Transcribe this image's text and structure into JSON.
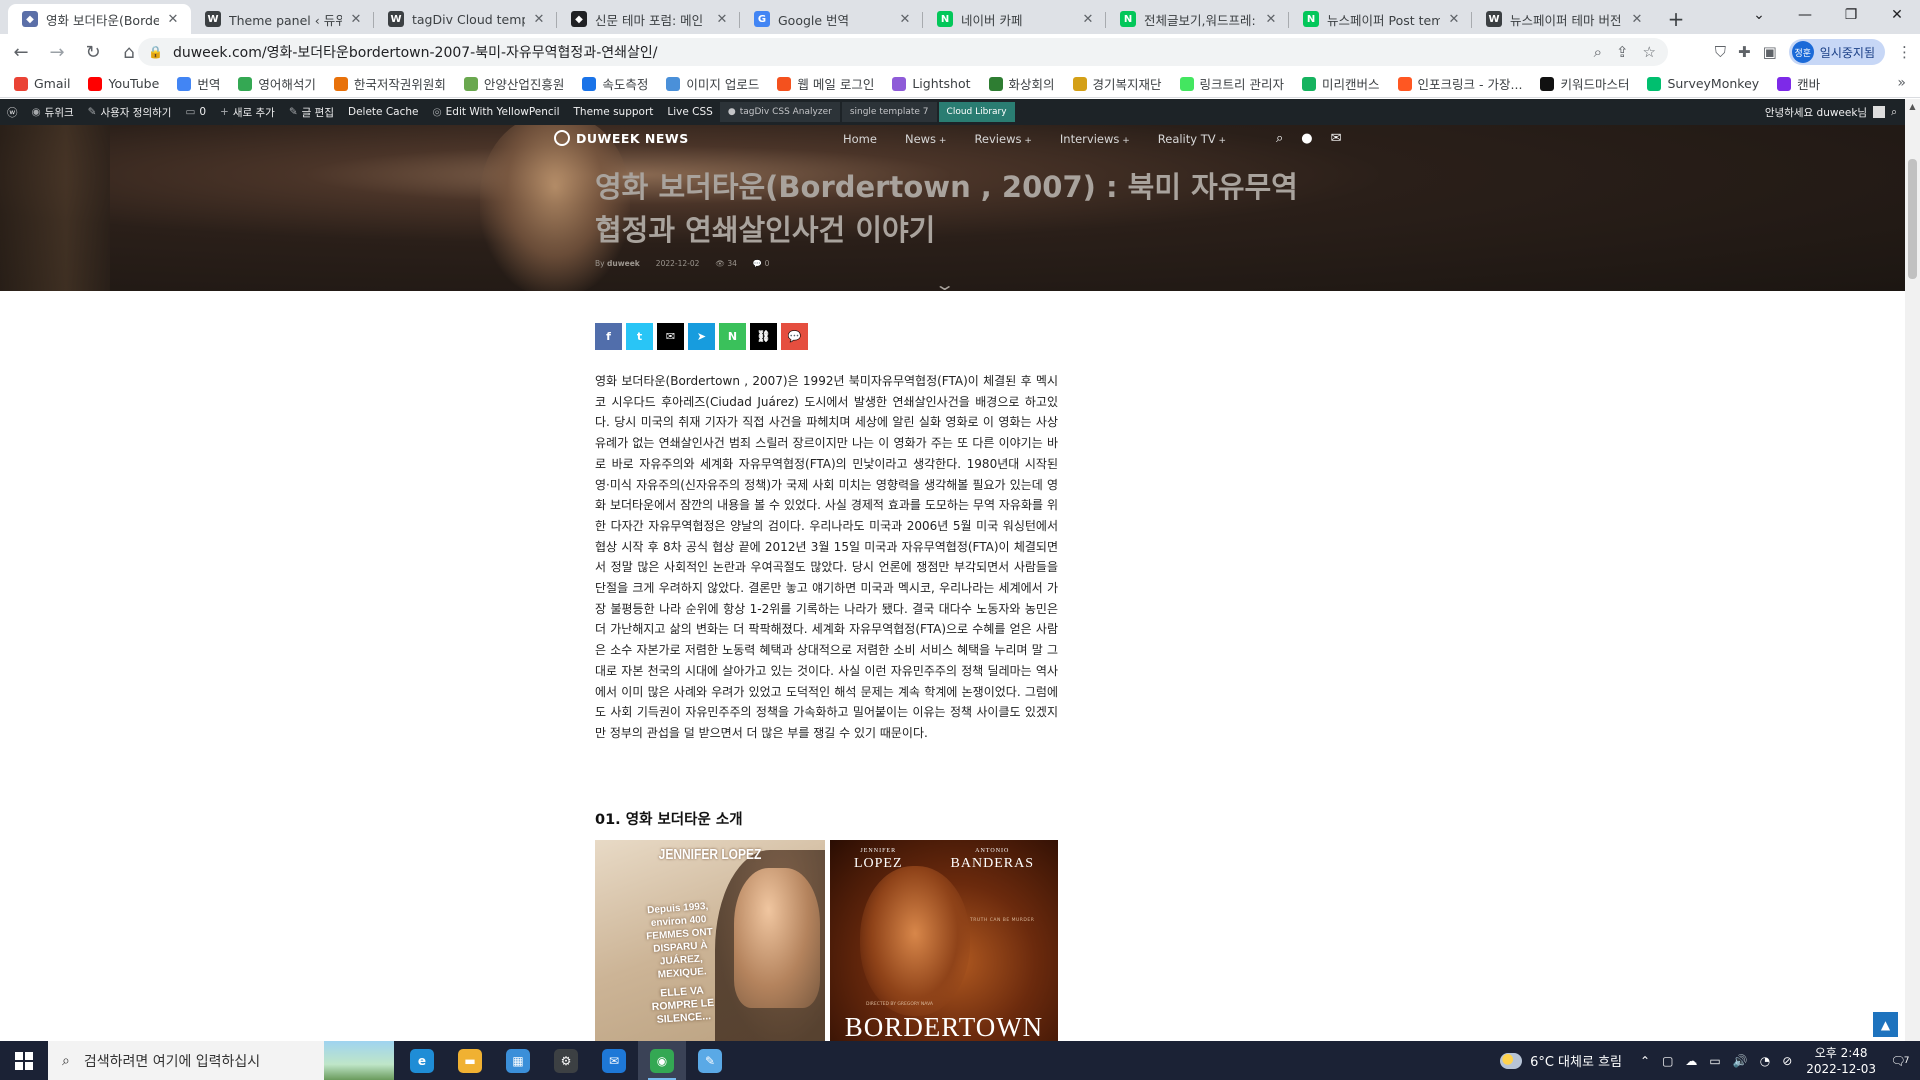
{
  "browser": {
    "tabs": [
      {
        "title": "영화 보더타운(Border",
        "favicon": "gear-icon",
        "color": "#5b6fa8",
        "active": true
      },
      {
        "title": "Theme panel ‹ 듀위크",
        "favicon": "wordpress-icon",
        "color": "#3c4043",
        "active": false
      },
      {
        "title": "tagDiv Cloud templat",
        "favicon": "wordpress-icon",
        "color": "#3c4043",
        "active": false
      },
      {
        "title": "신문 테마 포럼: 메인",
        "favicon": "tagdiv-icon",
        "color": "#202124",
        "active": false
      },
      {
        "title": "Google 번역",
        "favicon": "google-translate-icon",
        "color": "#4285f4",
        "active": false
      },
      {
        "title": "네이버 카페",
        "favicon": "naver-cafe-icon",
        "color": "#03c75a",
        "active": false
      },
      {
        "title": "전체글보기,워드프레:",
        "favicon": "naver-cafe-icon",
        "color": "#03c75a",
        "active": false
      },
      {
        "title": "뉴스페이퍼 Post temp",
        "favicon": "naver-cafe-icon",
        "color": "#03c75a",
        "active": false
      },
      {
        "title": "뉴스페이퍼 테마 버전",
        "favicon": "wordpress-icon",
        "color": "#3c4043",
        "active": false
      }
    ],
    "url": "duweek.com/영화-보더타운bordertown-2007-북미-자유무역협정과-연쇄살인/",
    "profile_label": "일시중지됨",
    "profile_avatar": "정훈"
  },
  "bookmarks": [
    {
      "label": "Gmail",
      "color": "#ea4335",
      "icon": "gmail-icon"
    },
    {
      "label": "YouTube",
      "color": "#ff0000",
      "icon": "youtube-icon"
    },
    {
      "label": "번역",
      "color": "#4285f4",
      "icon": "translate-icon"
    },
    {
      "label": "영어해석기",
      "color": "#34a853",
      "icon": "app-icon"
    },
    {
      "label": "한국저작권위원회",
      "color": "#e8710a",
      "icon": "copyright-icon"
    },
    {
      "label": "안양산업진흥원",
      "color": "#6aa84f",
      "icon": "org-icon"
    },
    {
      "label": "속도측정",
      "color": "#1a73e8",
      "icon": "speed-icon"
    },
    {
      "label": "이미지 업로드",
      "color": "#4a90d9",
      "icon": "image-icon"
    },
    {
      "label": "웹 메일 로그인",
      "color": "#f4511e",
      "icon": "mail-icon"
    },
    {
      "label": "Lightshot",
      "color": "#8e5bd8",
      "icon": "lightshot-icon"
    },
    {
      "label": "화상회의",
      "color": "#2e7d32",
      "icon": "video-icon"
    },
    {
      "label": "경기복지재단",
      "color": "#d4a017",
      "icon": "org-icon"
    },
    {
      "label": "링크트리 관리자",
      "color": "#43e660",
      "icon": "linktree-icon"
    },
    {
      "label": "미리캔버스",
      "color": "#16b35f",
      "icon": "canvas-icon"
    },
    {
      "label": "인포크링크 - 가장...",
      "color": "#ff5722",
      "icon": "link-icon"
    },
    {
      "label": "키워드마스터",
      "color": "#111111",
      "icon": "keyword-icon"
    },
    {
      "label": "SurveyMonkey",
      "color": "#00bf6f",
      "icon": "survey-icon"
    },
    {
      "label": "캔바",
      "color": "#7d2ae8",
      "icon": "canva-icon"
    }
  ],
  "adminbar": {
    "items": [
      "듀위크",
      "사용자 정의하기",
      "0",
      "새로 추가",
      "글 편집",
      "Delete Cache",
      "Edit With YellowPencil",
      "Theme support",
      "Live CSS"
    ],
    "tools": [
      "tagDiv CSS Analyzer",
      "single template 7",
      "Cloud Library"
    ],
    "greeting": "안녕하세요 duweek님"
  },
  "site": {
    "logo": "DUWEEK NEWS",
    "menu": [
      "Home",
      "News",
      "Reviews",
      "Interviews",
      "Reality TV"
    ],
    "headline": "영화 보더타운(Bordertown , 2007) : 북미 자유무역협정과 연쇄살인사건 이야기",
    "meta": {
      "by": "By",
      "author": "duweek",
      "date": "2022-12-02",
      "views": "34",
      "comments": "0"
    },
    "share": [
      {
        "name": "facebook-share-button",
        "glyph": "f",
        "color": "#516eab"
      },
      {
        "name": "twitter-share-button",
        "glyph": "t",
        "color": "#29c5f6"
      },
      {
        "name": "email-share-button",
        "glyph": "✉",
        "color": "#000000"
      },
      {
        "name": "telegram-share-button",
        "glyph": "➤",
        "color": "#179cde"
      },
      {
        "name": "naver-share-button",
        "glyph": "N",
        "color": "#3ac15b"
      },
      {
        "name": "copy-link-button",
        "glyph": "⛓",
        "color": "#000000"
      },
      {
        "name": "kakao-share-button",
        "glyph": "💬",
        "color": "#e54e3f"
      }
    ],
    "body": "영화 보더타운(Bordertown , 2007)은 1992년 북미자유무역협정(FTA)이 체결된 후 멕시코 시우다드 후아레즈(Ciudad Juárez) 도시에서 발생한 연쇄살인사건을 배경으로 하고있다. 당시 미국의 취재 기자가 직접 사건을 파헤치며 세상에 알린 실화 영화로 이 영화는 사상 유례가 없는 연쇄살인사건 범죄 스릴러 장르이지만 나는 이 영화가 주는 또 다른 이야기는 바로 바로 자유주의와 세계화 자유무역협정(FTA)의 민낯이라고 생각한다. 1980년대 시작된 영·미식 자유주의(신자유주의 정책)가 국제 사회 미치는 영향력을 생각해볼 필요가 있는데 영화 보더타운에서 잠깐의 내용을 볼 수 있었다. 사실 경제적 효과를 도모하는 무역 자유화를 위한 다자간 자유무역협정은 양날의 검이다. 우리나라도 미국과 2006년 5월 미국 워싱턴에서 협상 시작 후 8차 공식 협상 끝에 2012년 3월 15일 미국과 자유무역협정(FTA)이 체결되면서 정말 많은 사회적인 논란과 우여곡절도 많았다. 당시 언론에 쟁점만 부각되면서 사람들을 단절을 크게 우려하지 않았다. 결론만 놓고 얘기하면 미국과 멕시코, 우리나라는 세계에서 가장 불평등한 나라 순위에 항상 1-2위를 기록하는 나라가 됐다. 결국 대다수 노동자와 농민은 더 가난해지고 삶의 변화는 더 팍팍해졌다. 세계화 자유무역협정(FTA)으로 수혜를 얻은 사람은 소수 자본가로 저렴한 노동력 혜택과 상대적으로 저렴한 소비 서비스 혜택을 누리며 말 그대로 자본 천국의 시대에 살아가고 있는 것이다. 사실 이런 자유민주주의 정책 딜레마는 역사에서 이미 많은 사례와 우려가 있었고 도덕적인 해석 문제는 계속 학계에 논쟁이었다. 그럼에도 사회 기득권이 자유민주주의 정책을 가속화하고 밀어붙이는 이유는 정책 사이클도 있겠지만 정부의 관섭을 덜 받으면서 더 많은 부를 쟁길 수 있기 때문이다.",
    "subheading": "01. 영화 보더타운 소개",
    "poster1": {
      "title": "JENNIFER LOPEZ",
      "tagline": "Depuis 1993, environ 400 FEMMES ONT DISPARU À JUÁREZ, MEXIQUE.",
      "tagline2": "ELLE VA ROMPRE LE SILENCE..."
    },
    "poster2": {
      "actor1_first": "JENNIFER",
      "actor1_last": "LOPEZ",
      "actor2_first": "ANTONIO",
      "actor2_last": "BANDERAS",
      "tagline": "TRUTH CAN BE MURDER",
      "director": "DIRECTED BY GREGORY NAVA",
      "title": "BORDERTOWN"
    }
  },
  "taskbar": {
    "search_placeholder": "검색하려면 여기에 입력하십시",
    "apps": [
      {
        "name": "edge-taskbar-icon",
        "glyph": "e",
        "color": "#1f8dd6"
      },
      {
        "name": "file-explorer-taskbar-icon",
        "glyph": "▬",
        "color": "#f0b132"
      },
      {
        "name": "store-taskbar-icon",
        "glyph": "▦",
        "color": "#3b8fd9"
      },
      {
        "name": "settings-taskbar-icon",
        "glyph": "⚙",
        "color": "#3c4043"
      },
      {
        "name": "mail-taskbar-icon",
        "glyph": "✉",
        "color": "#1e78d7"
      },
      {
        "name": "chrome-taskbar-icon",
        "glyph": "◉",
        "color": "#34a853"
      },
      {
        "name": "notepad-taskbar-icon",
        "glyph": "✎",
        "color": "#5aa9e6"
      }
    ],
    "weather": "6°C  대체로 흐림",
    "time": "오후 2:48",
    "date": "2022-12-03",
    "notifications": "7"
  }
}
